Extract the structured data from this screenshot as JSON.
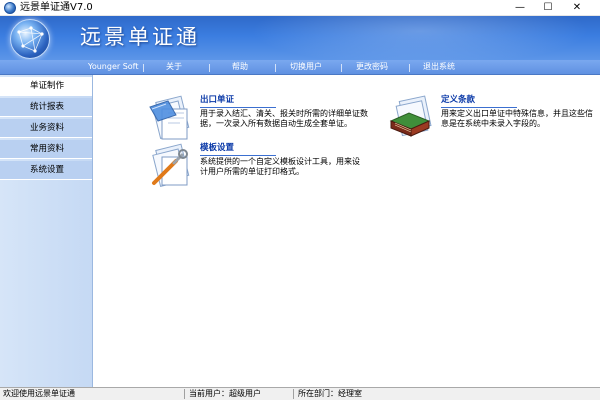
{
  "window": {
    "title": "远景单证通V7.0",
    "controls": [
      "—",
      "☐",
      "✕"
    ]
  },
  "header": {
    "brand": "远景单证通"
  },
  "menubar": {
    "items": [
      "Younger Soft",
      "关于",
      "帮助",
      "切换用户",
      "更改密码",
      "退出系统"
    ],
    "separator": "|"
  },
  "sidebar": {
    "items": [
      "单证制作",
      "统计报表",
      "业务资料",
      "常用资料",
      "系统设置"
    ],
    "active_index": 0
  },
  "features": [
    {
      "title": "出口单证",
      "description": "用于录入结汇、清关、报关时所需的详细单证数据，一次录入所有数据自动生成全套单证。"
    },
    {
      "title": "定义条款",
      "description": "用来定义出口单证中特殊信息，并且这些信息是在系统中未录入字段的。"
    },
    {
      "title": "模板设置",
      "description": "系统提供的一个自定义模板设计工具，用来设计用户所需的单证打印格式。"
    }
  ],
  "statusbar": {
    "welcome": "欢迎使用远景单证通",
    "current_user": "当前用户：超级用户",
    "department": "所在部门：经理室"
  },
  "colors": {
    "banner": "#3b7de0",
    "menubar": "#6a9be6",
    "sidebar": "#c5d9f4",
    "link": "#0b3aa8"
  }
}
